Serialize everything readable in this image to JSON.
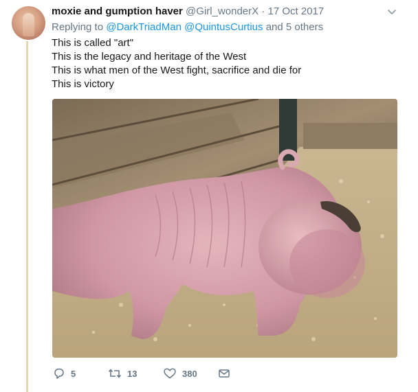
{
  "tweet": {
    "author_name": "moxie and gumption haver",
    "author_handle": "@Girl_wonderX",
    "separator": "·",
    "date": "17 Oct 2017",
    "replying_prefix": "Replying to",
    "replying_users": [
      "@DarkTriadMan",
      "@QuintusCurtius"
    ],
    "replying_suffix": "and 5 others",
    "lines": [
      "This is called \"art\"",
      "This is the legacy and heritage of the West",
      "This is what men of the West fight, sacrifice and die for",
      "This is victory"
    ],
    "actions": {
      "replies": "5",
      "retweets": "13",
      "likes": "380"
    }
  },
  "icons": {
    "more": "chevron-down-icon",
    "reply": "reply-icon",
    "retweet": "retweet-icon",
    "like": "heart-icon",
    "message": "envelope-icon"
  },
  "colors": {
    "link": "#1b95e0",
    "muted": "#657786",
    "thread_line": "#e5d6b3"
  }
}
